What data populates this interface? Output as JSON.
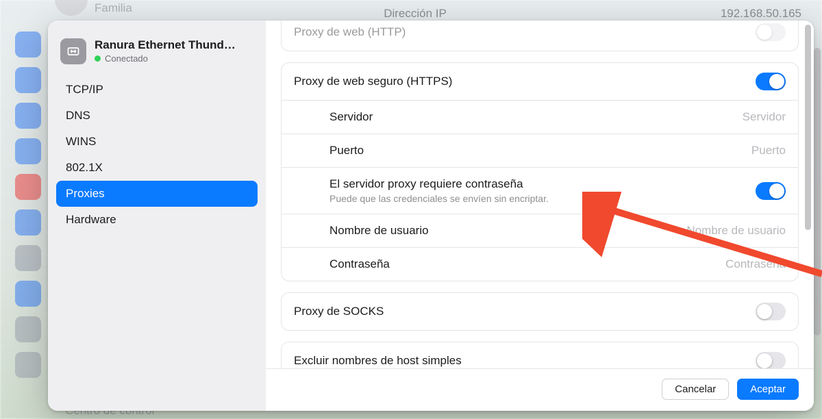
{
  "background": {
    "familia_label": "Familia",
    "ip_label": "Dirección IP",
    "ip_value": "192.168.50.165",
    "centro_control": "Centro de control"
  },
  "interface": {
    "name": "Ranura Ethernet Thund…",
    "status": "Conectado"
  },
  "sidebar": {
    "items": [
      {
        "label": "TCP/IP"
      },
      {
        "label": "DNS"
      },
      {
        "label": "WINS"
      },
      {
        "label": "802.1X"
      },
      {
        "label": "Proxies"
      },
      {
        "label": "Hardware"
      }
    ],
    "selected_index": 4
  },
  "proxies": {
    "http_label": "Proxy de web (HTTP)",
    "https": {
      "label": "Proxy de web seguro (HTTPS)",
      "enabled": true,
      "server_label": "Servidor",
      "server_placeholder": "Servidor",
      "server_value": "",
      "port_label": "Puerto",
      "port_placeholder": "Puerto",
      "port_value": "",
      "auth_label": "El servidor proxy requiere contraseña",
      "auth_hint": "Puede que las credenciales se envíen sin encriptar.",
      "auth_enabled": true,
      "user_label": "Nombre de usuario",
      "user_placeholder": "Nombre de usuario",
      "user_value": "",
      "pass_label": "Contraseña",
      "pass_placeholder": "Contraseña",
      "pass_value": ""
    },
    "socks": {
      "label": "Proxy de SOCKS",
      "enabled": false
    },
    "exclude_simple": {
      "label": "Excluir nombres de host simples",
      "enabled": false
    }
  },
  "footer": {
    "cancel": "Cancelar",
    "accept": "Aceptar"
  },
  "colors": {
    "accent": "#0a7aff",
    "arrow": "#f0492e"
  }
}
